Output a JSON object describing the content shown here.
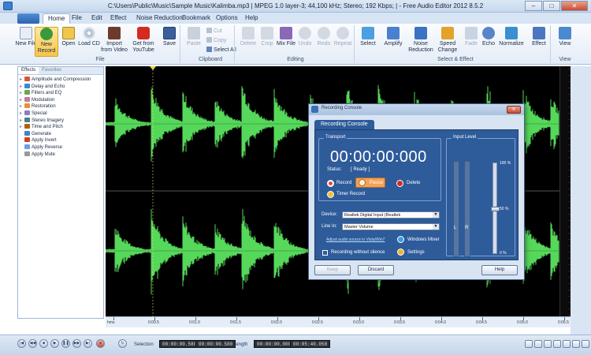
{
  "window": {
    "title": "C:\\Users\\Public\\Music\\Sample Music\\Kalimba.mp3 | MPEG 1.0 layer-3; 44,100 kHz; Stereo; 192 Kbps; | - Free Audio Editor 2012 8.5.2",
    "minimize": "–",
    "maximize": "□",
    "close": "✕"
  },
  "menu": {
    "tabs": [
      "Home",
      "File",
      "Edit",
      "Effect",
      "Noise Reduction",
      "Bookmark",
      "Options",
      "Help"
    ],
    "active": "Home"
  },
  "ribbon": {
    "file_buttons": [
      "New File",
      "New Record",
      "Open",
      "Load CD",
      "Import from Video",
      "Get from YouTube",
      "Save"
    ],
    "file_group": "File",
    "clipboard": {
      "paste": "Paste",
      "cut": "Cut",
      "copy": "Copy",
      "select_all": "Select All",
      "group": "Clipboard"
    },
    "editing_buttons": [
      "Delete",
      "Crop",
      "Mix File",
      "Undo",
      "Redo",
      "Repeat"
    ],
    "editing_group": "Editing",
    "select_buttons": [
      "Select",
      "Amplify",
      "Noise Reduction",
      "Speed Change",
      "Fade",
      "Echo",
      "Normalize",
      "Effect"
    ],
    "select_group": "Select & Effect",
    "view_button": "View",
    "view_group": "View"
  },
  "left_panel": {
    "tabs": [
      "Effects",
      "Favorites"
    ],
    "items": [
      "Amplitude and Compression",
      "Delay and Echo",
      "Filters and EQ",
      "Modulation",
      "Restoration",
      "Special",
      "Stereo Imagery",
      "Time and Pitch",
      "Generate",
      "Apply Invert",
      "Apply Reverse",
      "Apply Mute"
    ]
  },
  "timeline": {
    "labels": [
      "hms",
      "0:00.5",
      "0:01.0",
      "0:01.5",
      "0:02.0",
      "0:02.5",
      "0:03.0",
      "0:03.5",
      "0:04.0",
      "0:04.5",
      "0:05.0",
      "0:05.5"
    ]
  },
  "status": {
    "selection_label": "Selection",
    "selection_start": "00:00:00.580",
    "selection_end": "00:00:00.580",
    "length_label": "Length",
    "length_start": "00:00:00.000",
    "length_end": "00:05:40.058"
  },
  "dialog": {
    "title": "Recording Console",
    "tab": "Recording Console",
    "close": "✕",
    "transport_label": "Transport",
    "time": "00:00:00:000",
    "status_label": "Status:",
    "status_value": "[ Ready ]",
    "record": "Record",
    "pause": "Pause",
    "delete": "Delete",
    "timer_record": "Timer Record",
    "device_label": "Device:",
    "device_value": "Realtek Digital Input (Realtek",
    "line_in_label": "Line In:",
    "line_in_value": "Master Volume",
    "adjust_link": "Adjust audio source in Vista/Win7",
    "windows_mixer": "Windows Mixer",
    "recording_without_silence": "Recording without silence",
    "settings": "Settings",
    "input_level_label": "Input Level",
    "level_100": "100 %",
    "level_50": "50 %",
    "level_0": "0 %",
    "left_channel": "L",
    "right_channel": "R",
    "keep": "Keep",
    "discard": "Discard",
    "help": "Help",
    "input_level_fraction": 0.5
  },
  "colors": {
    "waveform": "#56d85a",
    "wave_bg": "#000000",
    "dialog_body": "#2e5b9a",
    "pause_accent": "#f3a25a"
  }
}
